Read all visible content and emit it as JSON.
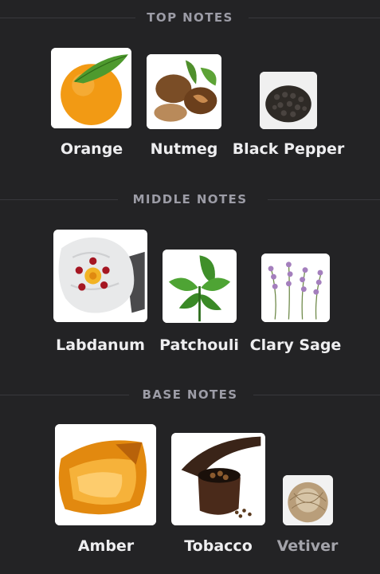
{
  "sections": {
    "top": {
      "title": "TOP NOTES",
      "notes": [
        {
          "name": "Orange",
          "icon": "orange-image"
        },
        {
          "name": "Nutmeg",
          "icon": "nutmeg-image"
        },
        {
          "name": "Black Pepper",
          "icon": "black-pepper-image"
        }
      ]
    },
    "middle": {
      "title": "MIDDLE NOTES",
      "notes": [
        {
          "name": "Labdanum",
          "icon": "labdanum-image"
        },
        {
          "name": "Patchouli",
          "icon": "patchouli-image"
        },
        {
          "name": "Clary Sage",
          "icon": "clary-sage-image"
        }
      ]
    },
    "base": {
      "title": "BASE NOTES",
      "notes": [
        {
          "name": "Amber",
          "icon": "amber-image"
        },
        {
          "name": "Tobacco",
          "icon": "tobacco-image"
        },
        {
          "name": "Vetiver",
          "icon": "vetiver-image"
        }
      ]
    }
  },
  "colors": {
    "background": "#232325",
    "header_text": "#9c9ca6",
    "label_text": "#eeeef0",
    "dim_label_text": "#a3a3aa"
  }
}
